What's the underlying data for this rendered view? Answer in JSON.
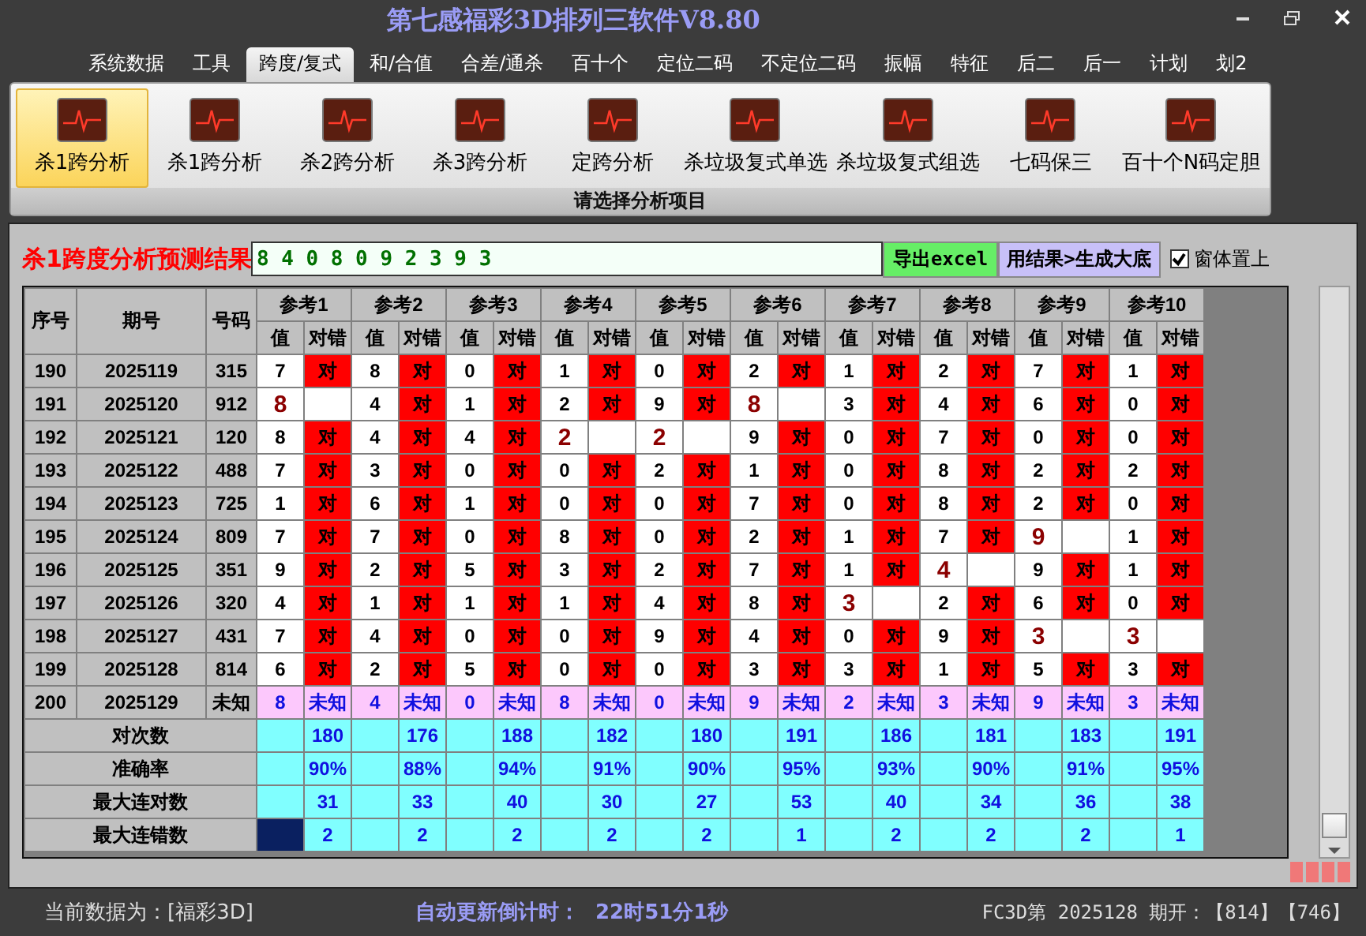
{
  "window": {
    "title": "第七感福彩3D排列三软件V8.80"
  },
  "menu": [
    {
      "label": "系统数据",
      "selected": false
    },
    {
      "label": "工具",
      "selected": false
    },
    {
      "label": "跨度/复式",
      "selected": true
    },
    {
      "label": "和/合值",
      "selected": false
    },
    {
      "label": "合差/通杀",
      "selected": false
    },
    {
      "label": "百十个",
      "selected": false
    },
    {
      "label": "定位二码",
      "selected": false
    },
    {
      "label": "不定位二码",
      "selected": false
    },
    {
      "label": "振幅",
      "selected": false
    },
    {
      "label": "特征",
      "selected": false
    },
    {
      "label": "后二",
      "selected": false
    },
    {
      "label": "后一",
      "selected": false
    },
    {
      "label": "计划",
      "selected": false
    },
    {
      "label": "划2",
      "selected": false
    }
  ],
  "ribbon": {
    "items": [
      {
        "label": "杀1跨分析",
        "selected": true
      },
      {
        "label": "杀1跨分析",
        "selected": false
      },
      {
        "label": "杀2跨分析",
        "selected": false
      },
      {
        "label": "杀3跨分析",
        "selected": false
      },
      {
        "label": "定跨分析",
        "selected": false
      },
      {
        "label": "杀垃圾复式单选",
        "selected": false
      },
      {
        "label": "杀垃圾复式组选",
        "selected": false
      },
      {
        "label": "七码保三",
        "selected": false
      },
      {
        "label": "百十个N码定胆",
        "selected": false
      }
    ],
    "group_label": "请选择分析项目"
  },
  "prediction": {
    "label": "杀1跨度分析预测结果",
    "value": "8 4 0 8 0 9 2 3 9 3",
    "export_button": "导出excel",
    "generate_button": "用结果>生成大底",
    "pin_checkbox": {
      "label": "窗体置上",
      "checked": true
    }
  },
  "table": {
    "columns": [
      "序号",
      "期号",
      "号码"
    ],
    "groups": [
      {
        "label": "参考1",
        "sub_columns": [
          "值",
          "对错"
        ]
      },
      {
        "label": "参考2",
        "sub_columns": [
          "值",
          "对错"
        ]
      },
      {
        "label": "参考3",
        "sub_columns": [
          "值",
          "对错"
        ]
      },
      {
        "label": "参考4",
        "sub_columns": [
          "值",
          "对错"
        ]
      },
      {
        "label": "参考5",
        "sub_columns": [
          "值",
          "对错"
        ]
      },
      {
        "label": "参考6",
        "sub_columns": [
          "值",
          "对错"
        ]
      },
      {
        "label": "参考7",
        "sub_columns": [
          "值",
          "对错"
        ]
      },
      {
        "label": "参考8",
        "sub_columns": [
          "值",
          "对错"
        ]
      },
      {
        "label": "参考9",
        "sub_columns": [
          "值",
          "对错"
        ]
      },
      {
        "label": "参考10",
        "sub_columns": [
          "值",
          "对错"
        ]
      }
    ],
    "rows": [
      {
        "kind": "history",
        "index": "190",
        "issue": "2025119",
        "number": "315",
        "cells": [
          {
            "value": "7",
            "result": "对",
            "hit": true
          },
          {
            "value": "8",
            "result": "对",
            "hit": true
          },
          {
            "value": "0",
            "result": "对",
            "hit": true
          },
          {
            "value": "1",
            "result": "对",
            "hit": true
          },
          {
            "value": "0",
            "result": "对",
            "hit": true
          },
          {
            "value": "2",
            "result": "对",
            "hit": true
          },
          {
            "value": "1",
            "result": "对",
            "hit": true
          },
          {
            "value": "2",
            "result": "对",
            "hit": true
          },
          {
            "value": "7",
            "result": "对",
            "hit": true
          },
          {
            "value": "1",
            "result": "对",
            "hit": true
          }
        ]
      },
      {
        "kind": "history",
        "index": "191",
        "issue": "2025120",
        "number": "912",
        "cells": [
          {
            "value": "8",
            "hit": false
          },
          {
            "value": "4",
            "result": "对",
            "hit": true
          },
          {
            "value": "1",
            "result": "对",
            "hit": true
          },
          {
            "value": "2",
            "result": "对",
            "hit": true
          },
          {
            "value": "9",
            "result": "对",
            "hit": true
          },
          {
            "value": "8",
            "hit": false
          },
          {
            "value": "3",
            "result": "对",
            "hit": true
          },
          {
            "value": "4",
            "result": "对",
            "hit": true
          },
          {
            "value": "6",
            "result": "对",
            "hit": true
          },
          {
            "value": "0",
            "result": "对",
            "hit": true
          }
        ]
      },
      {
        "kind": "history",
        "index": "192",
        "issue": "2025121",
        "number": "120",
        "cells": [
          {
            "value": "8",
            "result": "对",
            "hit": true
          },
          {
            "value": "4",
            "result": "对",
            "hit": true
          },
          {
            "value": "4",
            "result": "对",
            "hit": true
          },
          {
            "value": "2",
            "hit": false
          },
          {
            "value": "2",
            "hit": false
          },
          {
            "value": "9",
            "result": "对",
            "hit": true
          },
          {
            "value": "0",
            "result": "对",
            "hit": true
          },
          {
            "value": "7",
            "result": "对",
            "hit": true
          },
          {
            "value": "0",
            "result": "对",
            "hit": true
          },
          {
            "value": "0",
            "result": "对",
            "hit": true
          }
        ]
      },
      {
        "kind": "history",
        "index": "193",
        "issue": "2025122",
        "number": "488",
        "cells": [
          {
            "value": "7",
            "result": "对",
            "hit": true
          },
          {
            "value": "3",
            "result": "对",
            "hit": true
          },
          {
            "value": "0",
            "result": "对",
            "hit": true
          },
          {
            "value": "0",
            "result": "对",
            "hit": true
          },
          {
            "value": "2",
            "result": "对",
            "hit": true
          },
          {
            "value": "1",
            "result": "对",
            "hit": true
          },
          {
            "value": "0",
            "result": "对",
            "hit": true
          },
          {
            "value": "8",
            "result": "对",
            "hit": true
          },
          {
            "value": "2",
            "result": "对",
            "hit": true
          },
          {
            "value": "2",
            "result": "对",
            "hit": true
          }
        ]
      },
      {
        "kind": "history",
        "index": "194",
        "issue": "2025123",
        "number": "725",
        "cells": [
          {
            "value": "1",
            "result": "对",
            "hit": true
          },
          {
            "value": "6",
            "result": "对",
            "hit": true
          },
          {
            "value": "1",
            "result": "对",
            "hit": true
          },
          {
            "value": "0",
            "result": "对",
            "hit": true
          },
          {
            "value": "0",
            "result": "对",
            "hit": true
          },
          {
            "value": "7",
            "result": "对",
            "hit": true
          },
          {
            "value": "0",
            "result": "对",
            "hit": true
          },
          {
            "value": "8",
            "result": "对",
            "hit": true
          },
          {
            "value": "2",
            "result": "对",
            "hit": true
          },
          {
            "value": "0",
            "result": "对",
            "hit": true
          }
        ]
      },
      {
        "kind": "history",
        "index": "195",
        "issue": "2025124",
        "number": "809",
        "cells": [
          {
            "value": "7",
            "result": "对",
            "hit": true
          },
          {
            "value": "7",
            "result": "对",
            "hit": true
          },
          {
            "value": "0",
            "result": "对",
            "hit": true
          },
          {
            "value": "8",
            "result": "对",
            "hit": true
          },
          {
            "value": "0",
            "result": "对",
            "hit": true
          },
          {
            "value": "2",
            "result": "对",
            "hit": true
          },
          {
            "value": "1",
            "result": "对",
            "hit": true
          },
          {
            "value": "7",
            "result": "对",
            "hit": true
          },
          {
            "value": "9",
            "hit": false
          },
          {
            "value": "1",
            "result": "对",
            "hit": true
          }
        ]
      },
      {
        "kind": "history",
        "index": "196",
        "issue": "2025125",
        "number": "351",
        "cells": [
          {
            "value": "9",
            "result": "对",
            "hit": true
          },
          {
            "value": "2",
            "result": "对",
            "hit": true
          },
          {
            "value": "5",
            "result": "对",
            "hit": true
          },
          {
            "value": "3",
            "result": "对",
            "hit": true
          },
          {
            "value": "2",
            "result": "对",
            "hit": true
          },
          {
            "value": "7",
            "result": "对",
            "hit": true
          },
          {
            "value": "1",
            "result": "对",
            "hit": true
          },
          {
            "value": "4",
            "hit": false
          },
          {
            "value": "9",
            "result": "对",
            "hit": true
          },
          {
            "value": "1",
            "result": "对",
            "hit": true
          }
        ]
      },
      {
        "kind": "history",
        "index": "197",
        "issue": "2025126",
        "number": "320",
        "cells": [
          {
            "value": "4",
            "result": "对",
            "hit": true
          },
          {
            "value": "1",
            "result": "对",
            "hit": true
          },
          {
            "value": "1",
            "result": "对",
            "hit": true
          },
          {
            "value": "1",
            "result": "对",
            "hit": true
          },
          {
            "value": "4",
            "result": "对",
            "hit": true
          },
          {
            "value": "8",
            "result": "对",
            "hit": true
          },
          {
            "value": "3",
            "hit": false
          },
          {
            "value": "2",
            "result": "对",
            "hit": true
          },
          {
            "value": "6",
            "result": "对",
            "hit": true
          },
          {
            "value": "0",
            "result": "对",
            "hit": true
          }
        ]
      },
      {
        "kind": "history",
        "index": "198",
        "issue": "2025127",
        "number": "431",
        "cells": [
          {
            "value": "7",
            "result": "对",
            "hit": true
          },
          {
            "value": "4",
            "result": "对",
            "hit": true
          },
          {
            "value": "0",
            "result": "对",
            "hit": true
          },
          {
            "value": "0",
            "result": "对",
            "hit": true
          },
          {
            "value": "9",
            "result": "对",
            "hit": true
          },
          {
            "value": "4",
            "result": "对",
            "hit": true
          },
          {
            "value": "0",
            "result": "对",
            "hit": true
          },
          {
            "value": "9",
            "result": "对",
            "hit": true
          },
          {
            "value": "3",
            "hit": false
          },
          {
            "value": "3",
            "hit": false
          }
        ]
      },
      {
        "kind": "history",
        "index": "199",
        "issue": "2025128",
        "number": "814",
        "cells": [
          {
            "value": "6",
            "result": "对",
            "hit": true
          },
          {
            "value": "2",
            "result": "对",
            "hit": true
          },
          {
            "value": "5",
            "result": "对",
            "hit": true
          },
          {
            "value": "0",
            "result": "对",
            "hit": true
          },
          {
            "value": "0",
            "result": "对",
            "hit": true
          },
          {
            "value": "3",
            "result": "对",
            "hit": true
          },
          {
            "value": "3",
            "result": "对",
            "hit": true
          },
          {
            "value": "1",
            "result": "对",
            "hit": true
          },
          {
            "value": "5",
            "result": "对",
            "hit": true
          },
          {
            "value": "3",
            "result": "对",
            "hit": true
          }
        ]
      },
      {
        "kind": "forecast",
        "index": "200",
        "issue": "2025129",
        "number": "未知",
        "cells": [
          {
            "value": "8",
            "result": "未知"
          },
          {
            "value": "4",
            "result": "未知"
          },
          {
            "value": "0",
            "result": "未知"
          },
          {
            "value": "8",
            "result": "未知"
          },
          {
            "value": "0",
            "result": "未知"
          },
          {
            "value": "9",
            "result": "未知"
          },
          {
            "value": "2",
            "result": "未知"
          },
          {
            "value": "3",
            "result": "未知"
          },
          {
            "value": "9",
            "result": "未知"
          },
          {
            "value": "3",
            "result": "未知"
          }
        ]
      }
    ],
    "stats": [
      {
        "label": "对次数",
        "selected": false,
        "values": [
          "180",
          "176",
          "188",
          "182",
          "180",
          "191",
          "186",
          "181",
          "183",
          "191"
        ]
      },
      {
        "label": "准确率",
        "selected": false,
        "values": [
          "90%",
          "88%",
          "94%",
          "91%",
          "90%",
          "95%",
          "93%",
          "90%",
          "91%",
          "95%"
        ]
      },
      {
        "label": "最大连对数",
        "selected": false,
        "values": [
          "31",
          "33",
          "40",
          "30",
          "27",
          "53",
          "40",
          "34",
          "36",
          "38"
        ]
      },
      {
        "label": "最大连错数",
        "selected": true,
        "values": [
          "2",
          "2",
          "2",
          "2",
          "2",
          "1",
          "2",
          "2",
          "2",
          "1"
        ]
      }
    ]
  },
  "status_bar": {
    "data_source": "当前数据为：[福彩3D]",
    "countdown_label": "自动更新倒计时：",
    "countdown": "22时51分1秒",
    "latest": "FC3D第 2025128 期开：【814】【746】"
  }
}
